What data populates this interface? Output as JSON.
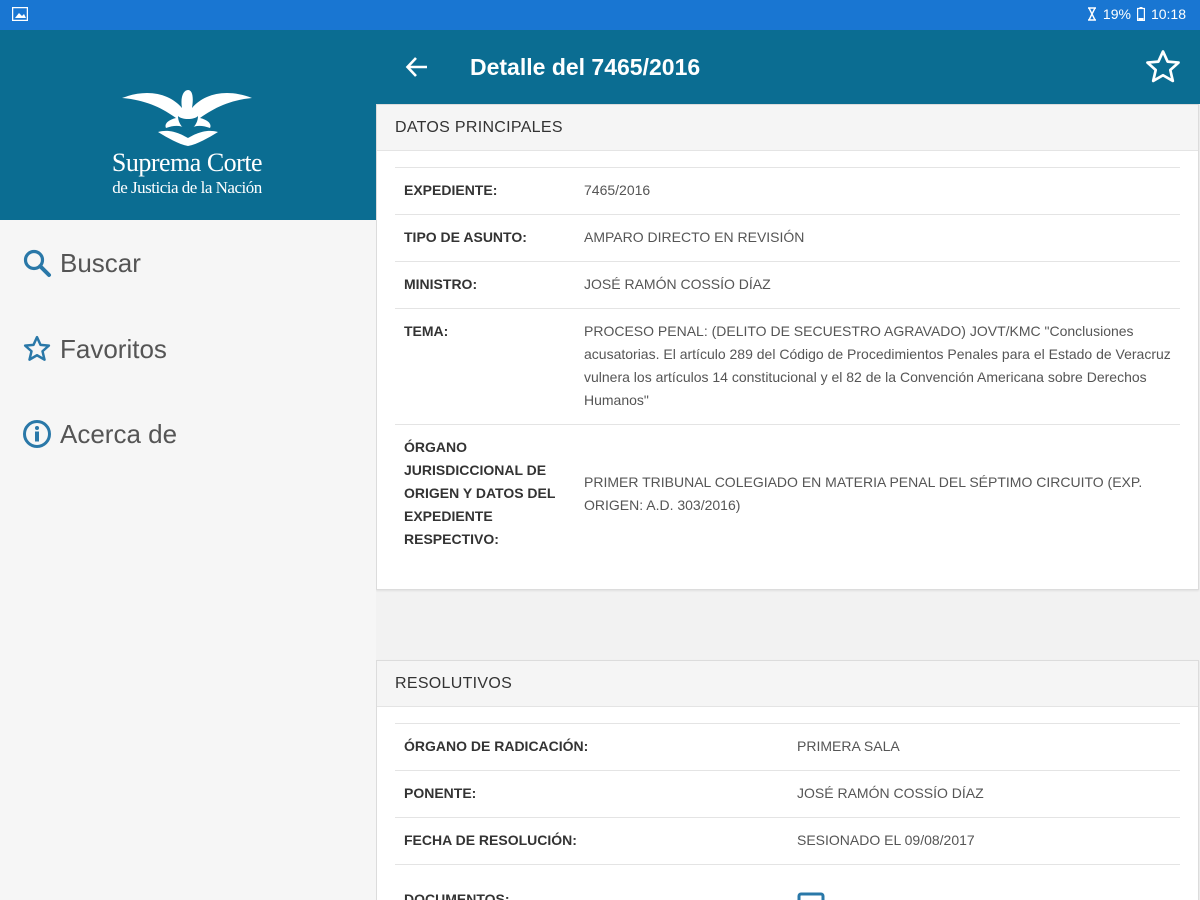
{
  "status_bar": {
    "battery": "19%",
    "time": "10:18"
  },
  "drawer": {
    "logo_line1": "Suprema Corte",
    "logo_line2": "de Justicia de la Nación",
    "items": [
      {
        "label": "Buscar",
        "icon": "search-icon"
      },
      {
        "label": "Favoritos",
        "icon": "star-icon"
      },
      {
        "label": "Acerca de",
        "icon": "info-icon"
      }
    ]
  },
  "appbar": {
    "title": "Detalle del 7465/2016"
  },
  "datos_principales": {
    "title": "DATOS PRINCIPALES",
    "rows": [
      {
        "key": "EXPEDIENTE:",
        "value": "7465/2016"
      },
      {
        "key": "TIPO DE ASUNTO:",
        "value": "AMPARO DIRECTO EN REVISIÓN"
      },
      {
        "key": "MINISTRO:",
        "value": "JOSÉ RAMÓN COSSÍO DÍAZ"
      },
      {
        "key": "TEMA:",
        "value": "PROCESO PENAL: (DELITO DE SECUESTRO AGRAVADO) JOVT/KMC \"Conclusiones acusatorias. El artículo 289 del Código de Procedimientos Penales para el Estado de Veracruz vulnera los artículos 14 constitucional y el 82 de la Convención Americana sobre Derechos Humanos\""
      },
      {
        "key": "ÓRGANO JURISDICCIONAL DE ORIGEN Y DATOS DEL EXPEDIENTE RESPECTIVO:",
        "value": "PRIMER TRIBUNAL COLEGIADO EN MATERIA PENAL DEL SÉPTIMO CIRCUITO (EXP. ORIGEN: A.D. 303/2016)"
      }
    ]
  },
  "resolutivos": {
    "title": "RESOLUTIVOS",
    "rows": [
      {
        "key": "ÓRGANO DE RADICACIÓN:",
        "value": "PRIMERA SALA"
      },
      {
        "key": "PONENTE:",
        "value": "JOSÉ RAMÓN COSSÍO DÍAZ"
      },
      {
        "key": "FECHA DE RESOLUCIÓN:",
        "value": "SESIONADO EL 09/08/2017"
      },
      {
        "key": "DOCUMENTOS:",
        "value": ""
      }
    ]
  },
  "colors": {
    "status_bar": "#1976d2",
    "primary": "#0b6d92",
    "drawer_icon": "#2a78a8"
  }
}
